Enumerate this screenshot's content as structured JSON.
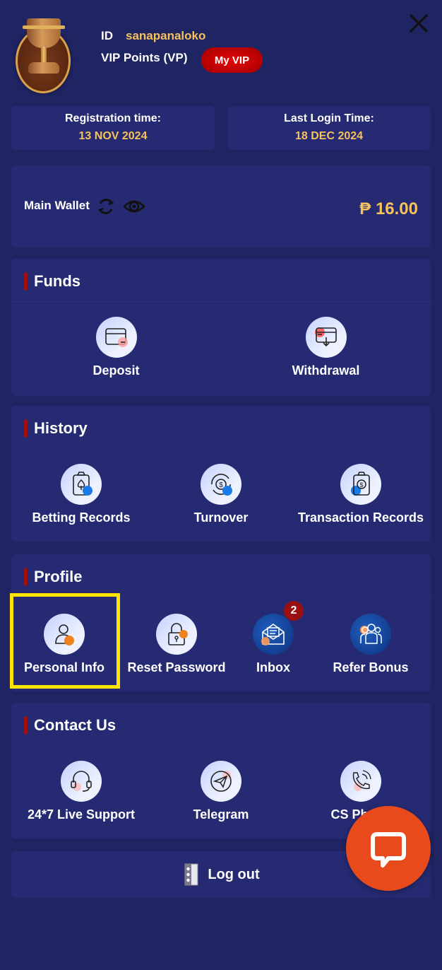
{
  "header": {
    "id_label": "ID",
    "username": "sanapanaloko",
    "vip_points_label": "VIP Points (VP)",
    "my_vip_button": "My VIP"
  },
  "info": {
    "registration_label": "Registration time:",
    "registration_value": "13 NOV 2024",
    "last_login_label": "Last Login Time:",
    "last_login_value": "18 DEC 2024"
  },
  "wallet": {
    "label": "Main Wallet",
    "amount": "₱ 16.00"
  },
  "sections": {
    "funds": {
      "title": "Funds",
      "items": [
        {
          "label": "Deposit",
          "icon": "deposit-card-icon"
        },
        {
          "label": "Withdrawal",
          "icon": "withdrawal-card-icon"
        }
      ]
    },
    "history": {
      "title": "History",
      "items": [
        {
          "label": "Betting Records",
          "icon": "clipboard-spade-icon"
        },
        {
          "label": "Turnover",
          "icon": "dollar-cycle-icon"
        },
        {
          "label": "Transaction Records",
          "icon": "clipboard-dollar-icon"
        }
      ]
    },
    "profile": {
      "title": "Profile",
      "items": [
        {
          "label": "Personal Info",
          "icon": "user-icon"
        },
        {
          "label": "Reset Password",
          "icon": "padlock-icon"
        },
        {
          "label": "Inbox",
          "icon": "envelope-icon",
          "badge": "2"
        },
        {
          "label": "Refer Bonus",
          "icon": "group-icon"
        }
      ]
    },
    "contact": {
      "title": "Contact Us",
      "items": [
        {
          "label": "24*7 Live Support",
          "icon": "headset-icon"
        },
        {
          "label": "Telegram",
          "icon": "telegram-icon"
        },
        {
          "label": "CS Phone",
          "icon": "phone-icon"
        }
      ]
    }
  },
  "logout": {
    "label": "Log out"
  },
  "colors": {
    "background": "#1f2462",
    "panel": "#252a72",
    "accent_gold": "#f5c25c",
    "section_bar": "#9b1111",
    "vip_red": "#d00000",
    "chat_orange": "#e84a1c",
    "highlight_yellow": "#ffe600"
  }
}
